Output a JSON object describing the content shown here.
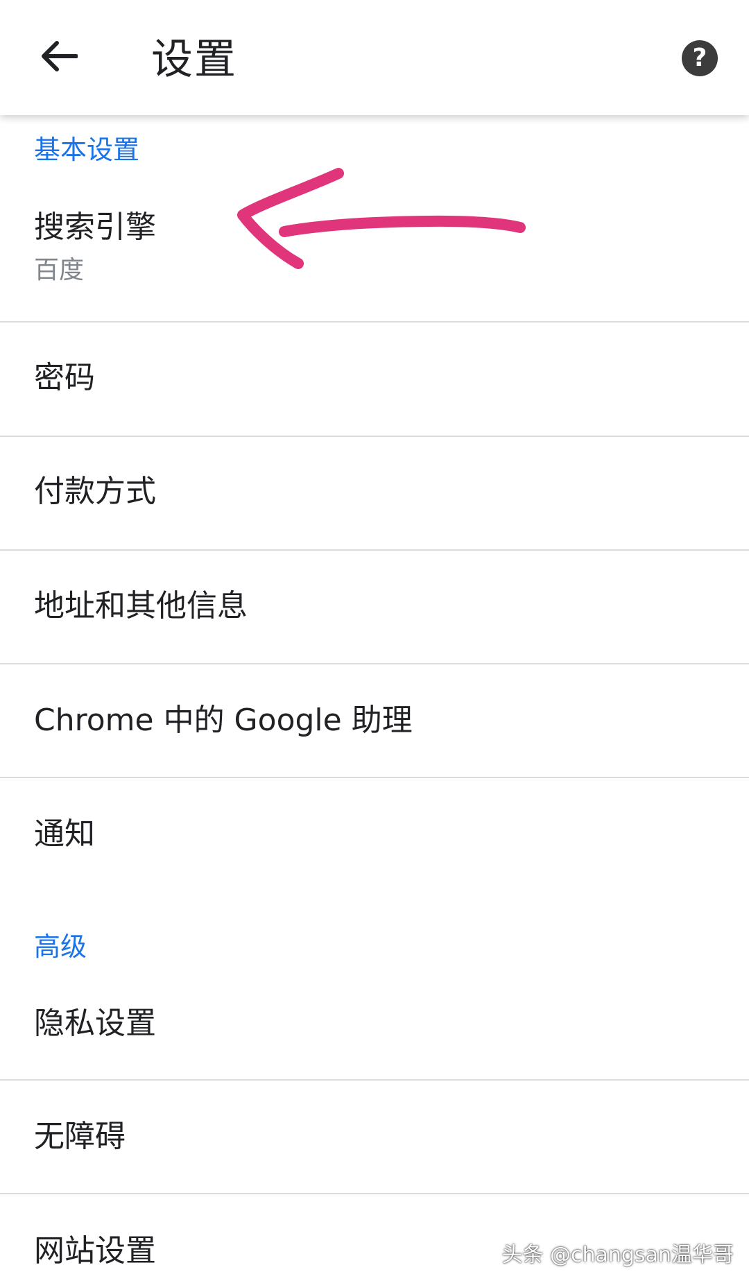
{
  "appbar": {
    "title": "设置"
  },
  "sections": {
    "basic": {
      "header": "基本设置",
      "search_engine": {
        "label": "搜索引擎",
        "value": "百度"
      },
      "passwords": {
        "label": "密码"
      },
      "payment_methods": {
        "label": "付款方式"
      },
      "addresses": {
        "label": "地址和其他信息"
      },
      "google_assistant": {
        "label": "Chrome 中的 Google 助理"
      },
      "notifications": {
        "label": "通知"
      }
    },
    "advanced": {
      "header": "高级",
      "privacy": {
        "label": "隐私设置"
      },
      "accessibility": {
        "label": "无障碍"
      },
      "site_settings": {
        "label": "网站设置"
      }
    }
  },
  "watermark": "头条 @changsan温华哥",
  "colors": {
    "section_header": "#1a73e8",
    "annotation_arrow": "#e0357a"
  }
}
